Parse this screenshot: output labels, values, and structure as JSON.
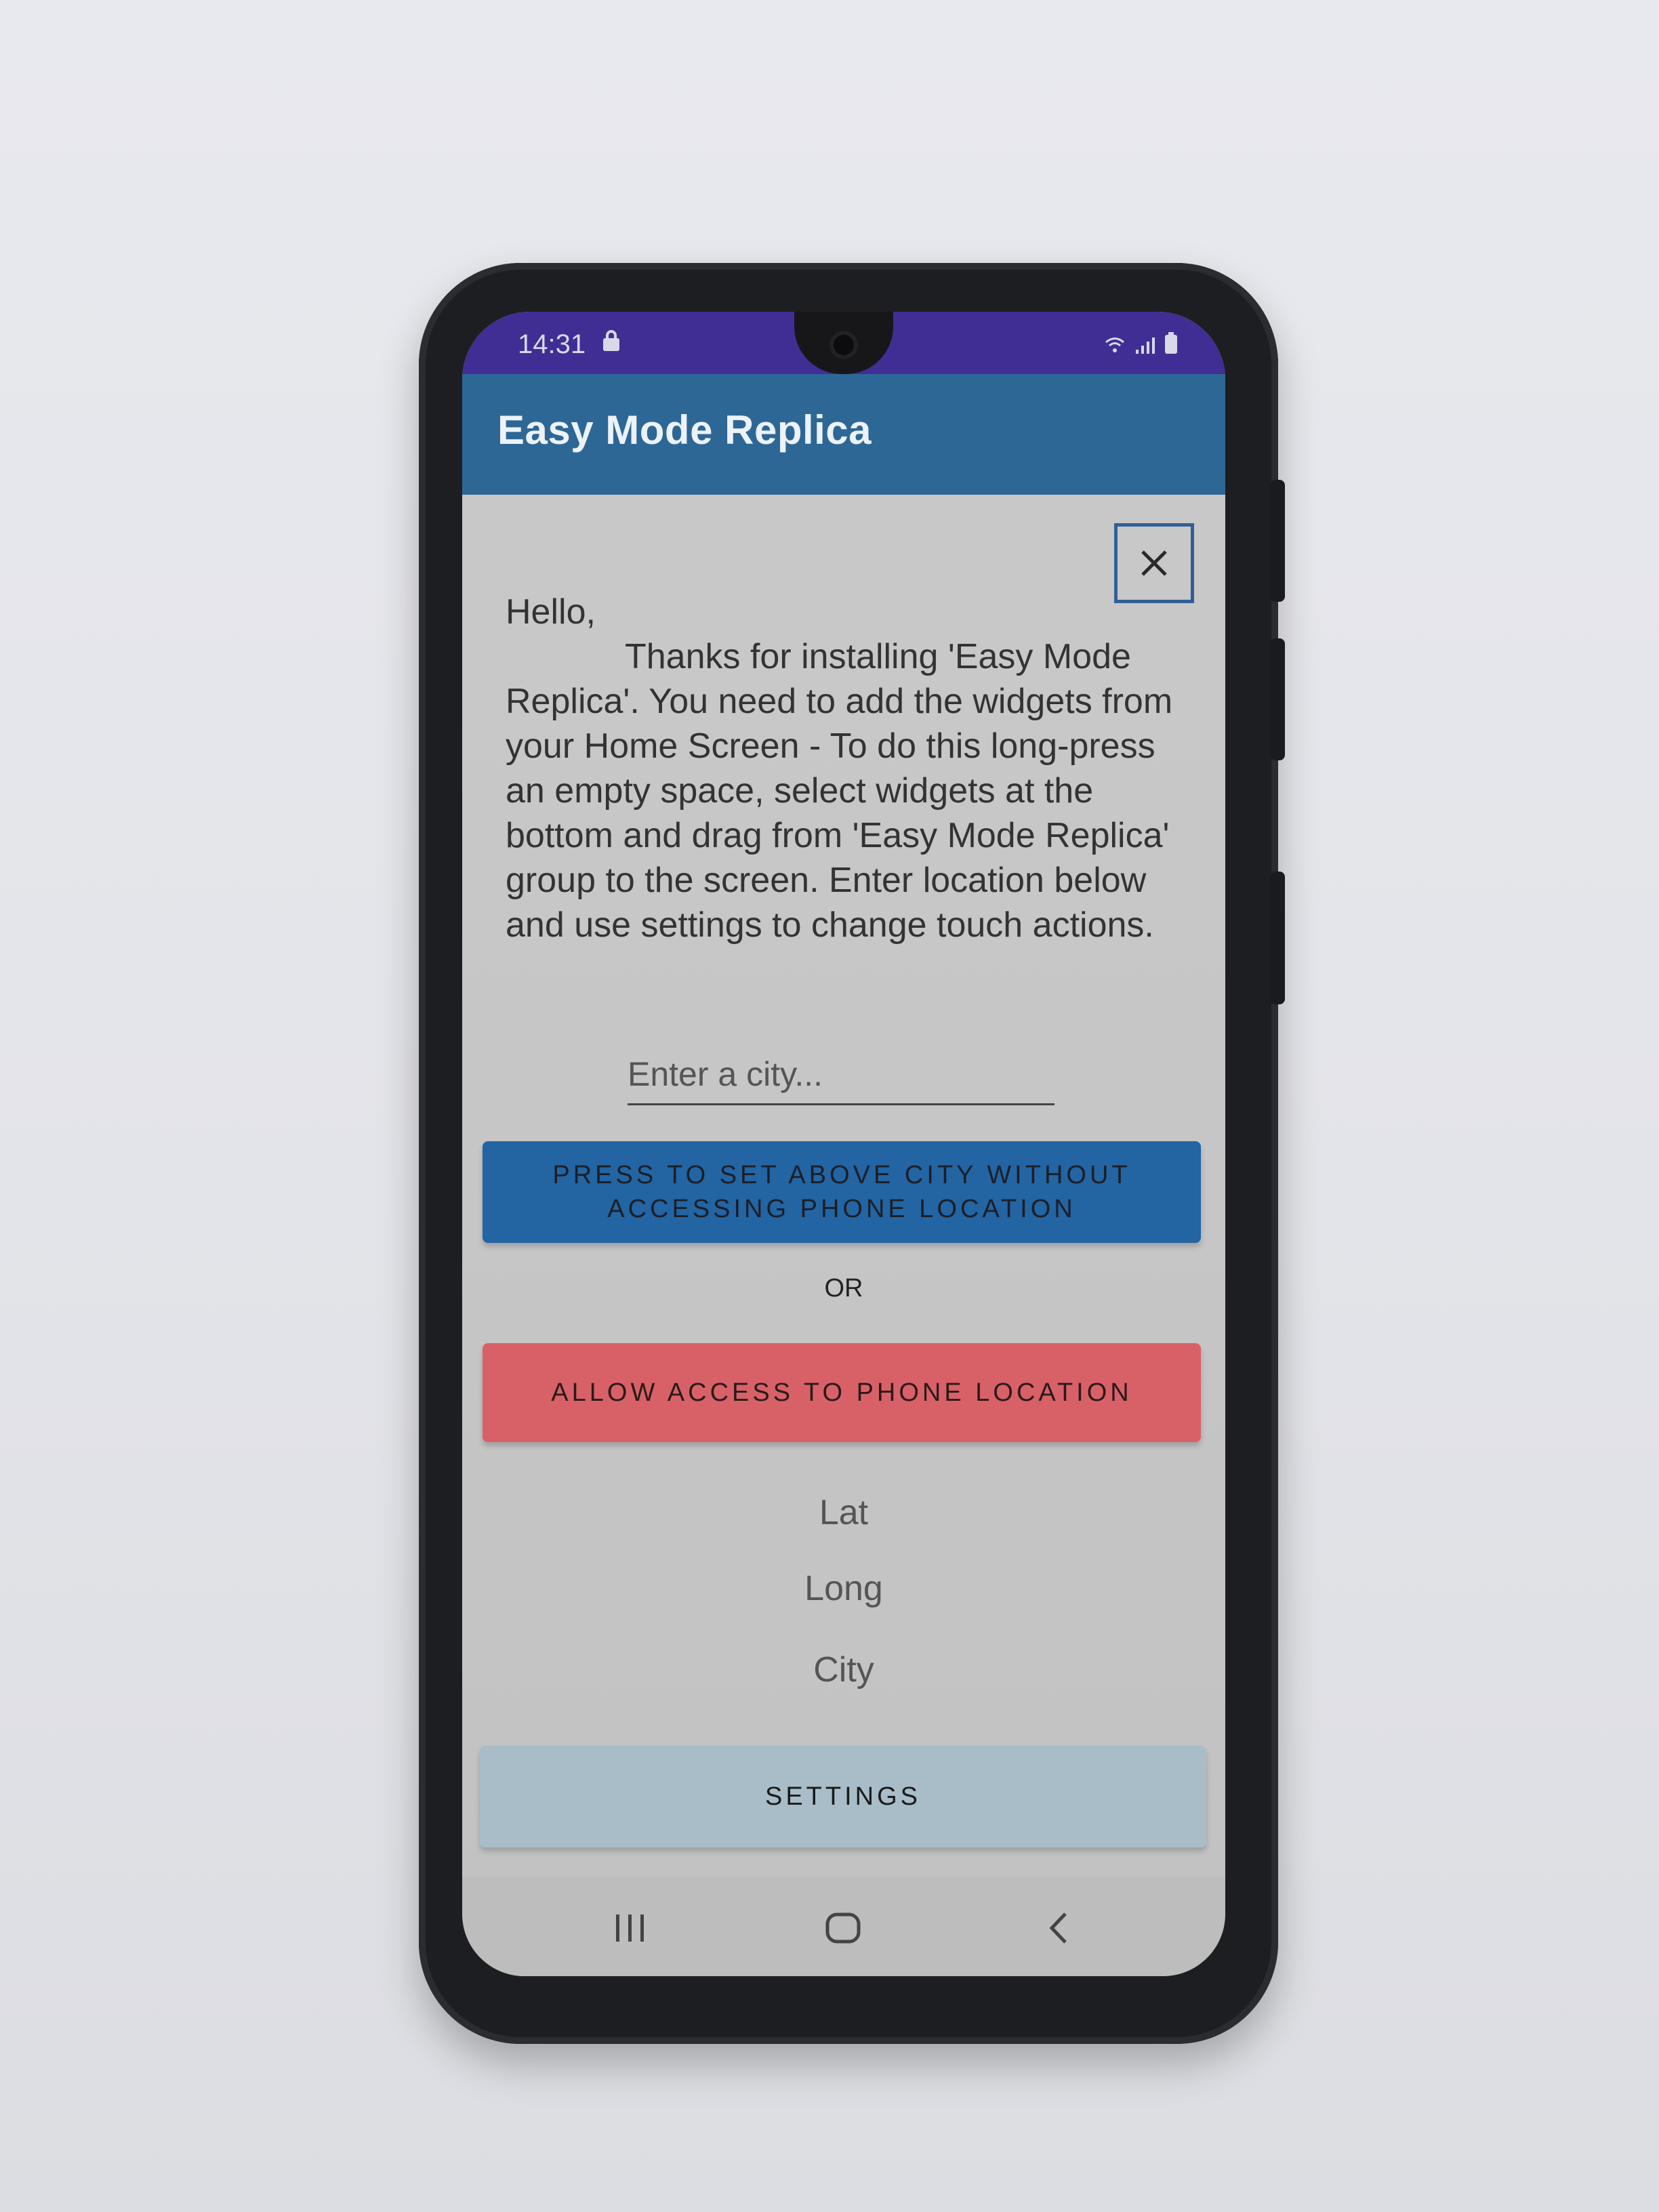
{
  "status_bar": {
    "time": "14:31"
  },
  "app_bar": {
    "title": "Easy Mode Replica"
  },
  "close": {
    "symbol": "✕"
  },
  "message": {
    "greeting": "Hello,",
    "body": "Thanks for installing 'Easy Mode Replica'. You need to add the widgets from your Home Screen - To do this long-press an empty space, select widgets at the bottom and drag from 'Easy Mode Replica' group to the screen. Enter location below and use settings to change touch actions."
  },
  "city_input": {
    "placeholder": "Enter a city...",
    "value": ""
  },
  "set_city_button": {
    "line1": "PRESS TO SET ABOVE CITY WITHOUT",
    "line2": "ACCESSING PHONE LOCATION"
  },
  "or_label": "OR",
  "allow_location_button": {
    "label": "ALLOW ACCESS TO PHONE LOCATION"
  },
  "location": {
    "lat_label": "Lat",
    "long_label": "Long",
    "city_label": "City"
  },
  "settings_button": {
    "label": "SETTINGS"
  },
  "colors": {
    "status_bar": "#402e94",
    "app_bar": "#2d6796",
    "set_city_button": "#2364a3",
    "allow_button": "#d86168",
    "settings_button": "#a8bdc8"
  },
  "icons": {
    "status": [
      "lock-icon",
      "wifi-icon",
      "signal-icon",
      "battery-icon"
    ],
    "nav": [
      "recents-icon",
      "home-icon",
      "back-icon"
    ]
  }
}
